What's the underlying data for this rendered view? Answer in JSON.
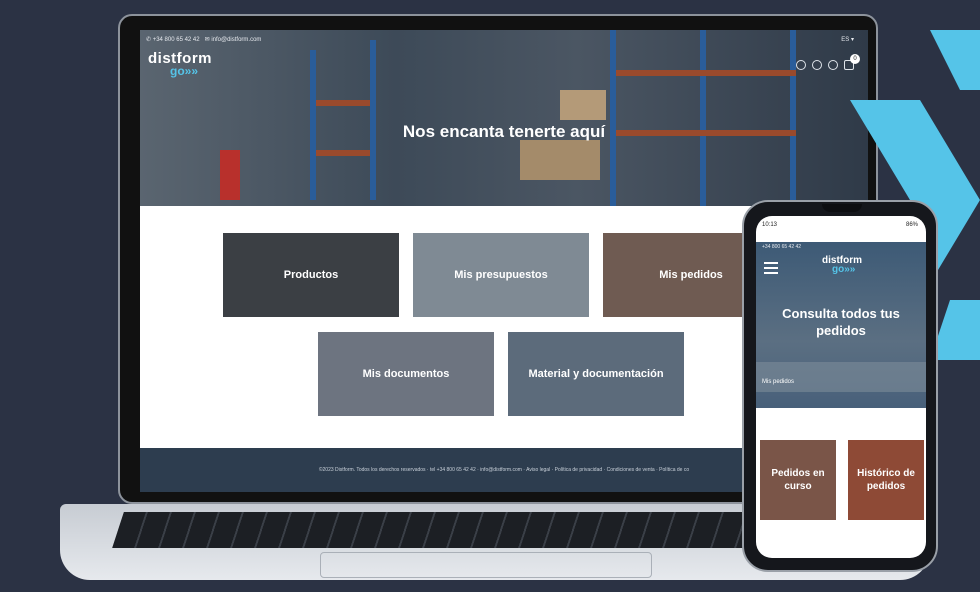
{
  "laptop": {
    "topbar": {
      "phone": "+34 800 65 42 42",
      "email": "info@distform.com",
      "language": "ES"
    },
    "logo": {
      "line1": "distform",
      "line2": "go»»"
    },
    "cart_count": "0",
    "hero_title": "Nos encanta tenerte aquí",
    "tiles": [
      {
        "label": "Productos",
        "color": "#3b3f44"
      },
      {
        "label": "Mis presupuestos",
        "color": "#7f8a94"
      },
      {
        "label": "Mis pedidos",
        "color": "#6f5b52"
      },
      {
        "label": "Mis documentos",
        "color": "#6d7480"
      },
      {
        "label": "Material y documentación",
        "color": "#5c6b7b"
      }
    ],
    "footer_text": "©2023 Distform. Todos los derechos reservados · tel +34 800 65 42 42 · info@distform.com · Aviso legal · Política de privacidad · Condiciones de venta · Política de co"
  },
  "phone": {
    "status_time": "10:13",
    "battery": "86%",
    "topbar": "+34 800 65 42 42",
    "logo": {
      "line1": "distform",
      "line2": "go»»"
    },
    "hero_title": "Consulta todos tus pedidos",
    "breadcrumb": "Mis pedidos",
    "tiles": [
      {
        "label": "Pedidos en curso",
        "color": "#7a5548"
      },
      {
        "label": "Histórico de pedidos",
        "color": "#8e4a36"
      }
    ]
  },
  "brand": {
    "accent": "#55c4e8",
    "background": "#2b3244"
  }
}
